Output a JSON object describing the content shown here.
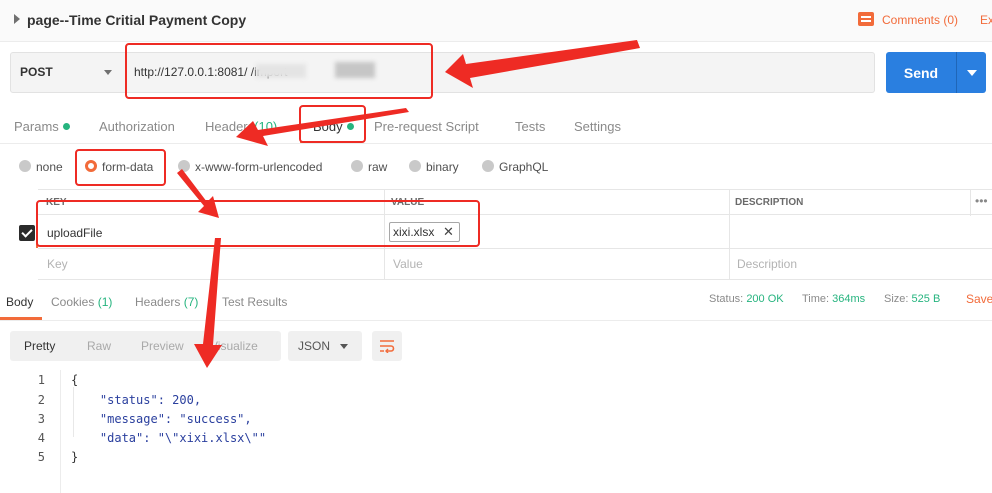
{
  "header": {
    "title": "page--Time Critial Payment Copy",
    "comments_label": "Comments (0)",
    "ex_label": "Ex"
  },
  "request": {
    "method": "POST",
    "url": "http://127.0.0.1:8081/                                /import",
    "url_prefix": "http://127.0.0.1:8081/",
    "url_suffix": "/import",
    "send_label": "Send"
  },
  "tabs": [
    {
      "label": "Params",
      "dot": true
    },
    {
      "label": "Authorization"
    },
    {
      "label": "Headers",
      "count": "(10)"
    },
    {
      "label": "Body",
      "dot": true
    },
    {
      "label": "Pre-request Script"
    },
    {
      "label": "Tests"
    },
    {
      "label": "Settings"
    }
  ],
  "body_types": [
    "none",
    "form-data",
    "x-www-form-urlencoded",
    "raw",
    "binary",
    "GraphQL"
  ],
  "body_type_selected": "form-data",
  "table": {
    "headers": [
      "KEY",
      "VALUE",
      "DESCRIPTION"
    ],
    "rows": [
      {
        "key": "uploadFile",
        "value": "xixi.xlsx",
        "checked": true
      }
    ],
    "placeholders": {
      "key": "Key",
      "value": "Value",
      "description": "Description"
    },
    "more": "•••"
  },
  "response": {
    "tabs": [
      {
        "label": "Body"
      },
      {
        "label": "Cookies",
        "count": "(1)"
      },
      {
        "label": "Headers",
        "count": "(7)"
      },
      {
        "label": "Test Results"
      }
    ],
    "status_label": "Status:",
    "status_value": "200 OK",
    "time_label": "Time:",
    "time_value": "364ms",
    "size_label": "Size:",
    "size_value": "525 B",
    "save_label": "Save",
    "view_modes": [
      "Pretty",
      "Raw",
      "Preview",
      "Visualize"
    ],
    "format": "JSON",
    "line_numbers": [
      "1",
      "2",
      "3",
      "4",
      "5"
    ],
    "code_lines": [
      "{",
      "    \"status\": 200,",
      "    \"message\": \"success\",",
      "    \"data\": \"\\\"xixi.xlsx\\\"\"",
      "}"
    ]
  },
  "colors": {
    "accent": "#f26b3a",
    "send": "#2a7fe0",
    "success": "#26b47f",
    "annotation": "#ee2b24"
  }
}
